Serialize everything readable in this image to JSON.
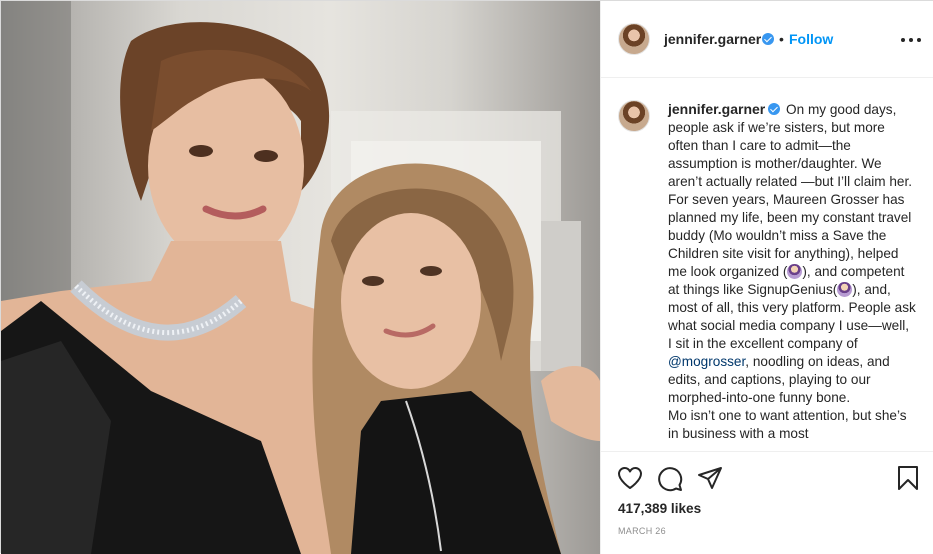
{
  "post": {
    "author": "jennifer.garner",
    "follow_label": "Follow",
    "separator": "•",
    "caption": {
      "p1": "On my good days, people ask if we’re sisters, but more often than I care to admit—the assumption is mother/daughter. We aren’t actually related —but I’ll claim her. For seven years, Maureen Grosser has planned my life, been my constant travel buddy (Mo wouldn’t miss a Save the Children site visit for anything), helped me look organized (",
      "p2": "), and competent at things like SignupGenius(",
      "p3": "), and, most of all, this very platform. People ask what social media company I use—well, I sit in the excellent company of ",
      "mention": "@mogrosser",
      "p4": ", noodling on ideas, and edits, and captions, playing to our morphed-into-one funny bone.",
      "p5": "Mo isn’t one to want attention, but she’s in business with a most"
    },
    "emoji_name": "woman-emoji",
    "likes_text": "417,389 likes",
    "date": "MARCH 26"
  },
  "icons": {
    "like": "heart-icon",
    "comment": "comment-icon",
    "share": "paper-plane-icon",
    "save": "bookmark-icon",
    "more": "more-options-icon",
    "verified": "verified-badge-icon"
  },
  "colors": {
    "link_blue": "#0095f6",
    "verified_blue": "#3897f0",
    "text": "#262626",
    "muted": "#8e8e8e",
    "border": "#dbdbdb"
  }
}
